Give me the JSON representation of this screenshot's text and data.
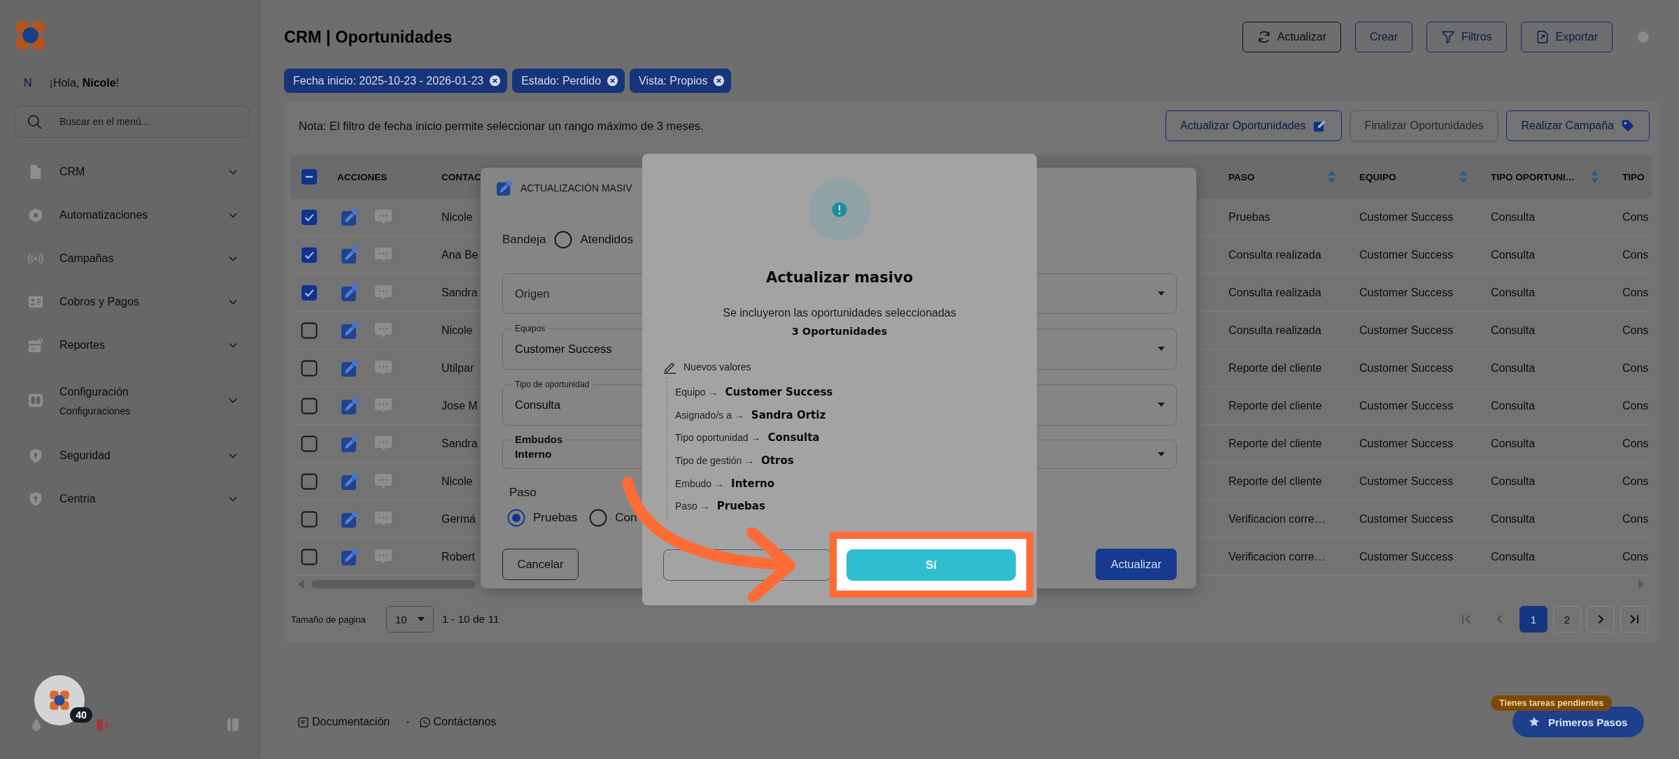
{
  "sidebar": {
    "greeting_initial": "N",
    "greeting": "¡Hola, **Nicole**!",
    "search": {
      "placeholder": "Buscar en el menú..."
    },
    "items": [
      {
        "label": "CRM",
        "expanded": false
      },
      {
        "label": "Automatizaciones",
        "expanded": false
      },
      {
        "label": "Campañas",
        "expanded": false
      },
      {
        "label": "Cobros y Pagos",
        "expanded": false
      },
      {
        "label": "Reportes",
        "expanded": false
      },
      {
        "label": "Configuración",
        "sublabel": "Configuraciones",
        "expanded": false
      },
      {
        "label": "Seguridad",
        "expanded": false
      },
      {
        "label": "Centria",
        "expanded": false
      }
    ],
    "launcher_badge": "40"
  },
  "header": {
    "title": "CRM | Oportunidades",
    "buttons": [
      {
        "label": "Actualizar",
        "kind": "neutral"
      },
      {
        "label": "Crear",
        "kind": "primary"
      },
      {
        "label": "Filtros",
        "kind": "primary"
      },
      {
        "label": "Exportar",
        "kind": "primary"
      }
    ]
  },
  "filters": [
    {
      "label": "Fecha inicio: 2025-10-23 - 2026-01-23"
    },
    {
      "label": "Estado: Perdido"
    },
    {
      "label": "Vista: Propios"
    }
  ],
  "note": "Nota: El filtro de fecha inicio permite seleccionar un rango máximo de 3 meses.",
  "actions": [
    {
      "label": "Actualizar Oportunidades",
      "disabled": false
    },
    {
      "label": "Finalizar Oportunidades",
      "disabled": true
    },
    {
      "label": "Realizar Campaña",
      "disabled": false
    }
  ],
  "table": {
    "select_all": {
      "indeterminate": true
    },
    "actions_column": "ACCIONES",
    "columns": [
      {
        "label": "CONTAC",
        "sortable": false
      },
      {
        "label": "PASO",
        "sortable": true
      },
      {
        "label": "EQUIPO",
        "sortable": true
      },
      {
        "label": "TIPO OPORTUNI…",
        "sortable": true
      },
      {
        "label": "TIPO",
        "sortable": false
      }
    ],
    "rows": [
      {
        "checked": true,
        "cells": [
          "Nicole",
          "Pruebas",
          "Customer Success",
          "Consulta",
          "Cons"
        ]
      },
      {
        "checked": true,
        "cells": [
          "Ana Be",
          "Consulta realizada",
          "Customer Success",
          "Consulta",
          "Cons"
        ]
      },
      {
        "checked": true,
        "cells": [
          "Sandra",
          "Consulta realizada",
          "Customer Success",
          "Consulta",
          "Cons"
        ]
      },
      {
        "checked": false,
        "cells": [
          "Nicole",
          "Consulta realizada",
          "Customer Success",
          "Consulta",
          "Cons"
        ]
      },
      {
        "checked": false,
        "cells": [
          "Utilpar",
          "Reporte del cliente",
          "Customer Success",
          "Consulta",
          "Cons"
        ]
      },
      {
        "checked": false,
        "cells": [
          "Jose M",
          "Reporte del cliente",
          "Customer Success",
          "Consulta",
          "Cons"
        ]
      },
      {
        "checked": false,
        "cells": [
          "Sandra",
          "Reporte del cliente",
          "Customer Success",
          "Consulta",
          "Cons"
        ]
      },
      {
        "checked": false,
        "cells": [
          "Nicole",
          "Reporte del cliente",
          "Customer Success",
          "Consulta",
          "Cons"
        ]
      },
      {
        "checked": false,
        "cells": [
          "Germá",
          "Verificacion corre…",
          "Customer Success",
          "Consulta",
          "Cons"
        ]
      },
      {
        "checked": false,
        "cells": [
          "Robert",
          "Verificacion corre…",
          "Customer Success",
          "Consulta",
          "Cons"
        ]
      }
    ]
  },
  "pagination": {
    "page_size_label": "Tamaño de pagina",
    "page_size": "10",
    "range": "1 - 10 de 11",
    "pages": [
      {
        "label": "1",
        "selected": true
      },
      {
        "label": "2",
        "selected": false
      }
    ]
  },
  "bulk_update_dialog": {
    "title": "ACTUALIZACIÓN MASIV",
    "tray": {
      "label": "Bandeja",
      "options": [
        {
          "label": "Atendidos",
          "selected": false
        }
      ]
    },
    "fields": [
      {
        "kind": "select",
        "placeholder": "Origen"
      },
      {
        "kind": "select",
        "label": "Equipos",
        "value": "Customer Success"
      },
      {
        "kind": "select",
        "label": "Tipo de oportunidad",
        "value": "Consulta"
      },
      {
        "kind": "dense",
        "label": "Embudos",
        "value": "Interno"
      }
    ],
    "step": {
      "label": "Paso",
      "options": [
        {
          "label": "Pruebas",
          "selected": true
        },
        {
          "label": "Con",
          "selected": false
        }
      ]
    },
    "cancel": "Cancelar",
    "submit": "Actualizar"
  },
  "confirm_dialog": {
    "title": "Actualizar masivo",
    "message": "Se incluyeron las oportunidades seleccionadas",
    "count": "3 Oportunidades",
    "changes_heading": "Nuevos valores",
    "changes": [
      {
        "field": "Equipo →",
        "value": "Customer Success"
      },
      {
        "field": "Asignado/s a →",
        "value": "Sandra Ortiz"
      },
      {
        "field": "Tipo oportunidad →",
        "value": "Consulta"
      },
      {
        "field": "Tipo de gestión →",
        "value": "Otros"
      },
      {
        "field": "Embudo →",
        "value": "Interno"
      },
      {
        "field": "Paso →",
        "value": "Pruebas"
      }
    ],
    "confirm": "Sí"
  },
  "footer": {
    "links": [
      {
        "label": "Documentación"
      },
      {
        "label": "Contáctanos"
      }
    ],
    "separator": "-"
  },
  "tasks_badge": "Tienes tareas pendientes",
  "getting_started_button": "Primeros Pasos"
}
